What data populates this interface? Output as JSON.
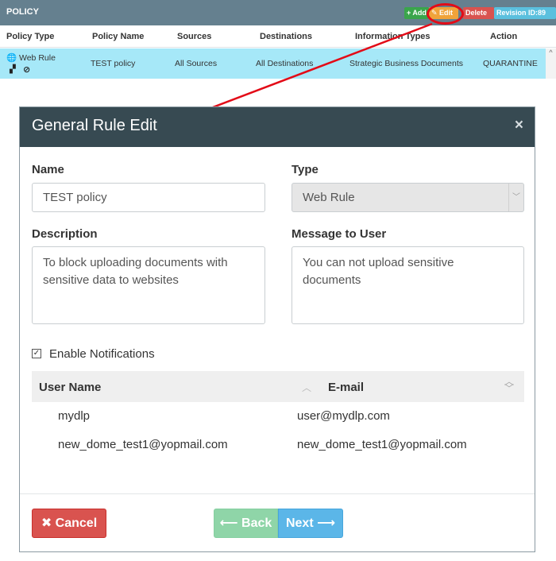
{
  "policy": {
    "title": "POLICY",
    "buttons": {
      "add": "+ Add",
      "edit": "✎ Edit",
      "delete": "Delete",
      "revision": "Revision ID:89"
    },
    "columns": [
      "Policy Type",
      "Policy Name",
      "Sources",
      "Destinations",
      "Information Types",
      "Action"
    ],
    "row": {
      "type": "Web Rule",
      "name": "TEST policy",
      "sources": "All Sources",
      "destinations": "All Destinations",
      "info_types": "Strategic Business Documents",
      "action": "QUARANTINE"
    },
    "colors": {
      "header": "#65808f",
      "row": "#a6e8f8",
      "highlight": "#e30b17"
    }
  },
  "modal": {
    "title": "General Rule Edit",
    "close_glyph": "×",
    "name_label": "Name",
    "name_value": "TEST policy",
    "type_label": "Type",
    "type_value": "Web Rule",
    "description_label": "Description",
    "description_value": "To block uploading documents with sensitive data to websites",
    "message_label": "Message to User",
    "message_value": "You can not upload sensitive documents",
    "notifications_checked": true,
    "notifications_label": "Enable Notifications",
    "users_table": {
      "headers": [
        "User Name",
        "E-mail"
      ],
      "rows": [
        {
          "name": "mydlp",
          "email": "user@mydlp.com"
        },
        {
          "name": "new_dome_test1@yopmail.com",
          "email": "new_dome_test1@yopmail.com"
        }
      ]
    },
    "buttons": {
      "cancel": "✖ Cancel",
      "back": "⟵ Back",
      "next": "Next ⟶"
    },
    "colors": {
      "header": "#374a52",
      "cancel": "#d9534f",
      "back": "#8fd5a8",
      "next": "#5bb6e8"
    }
  }
}
